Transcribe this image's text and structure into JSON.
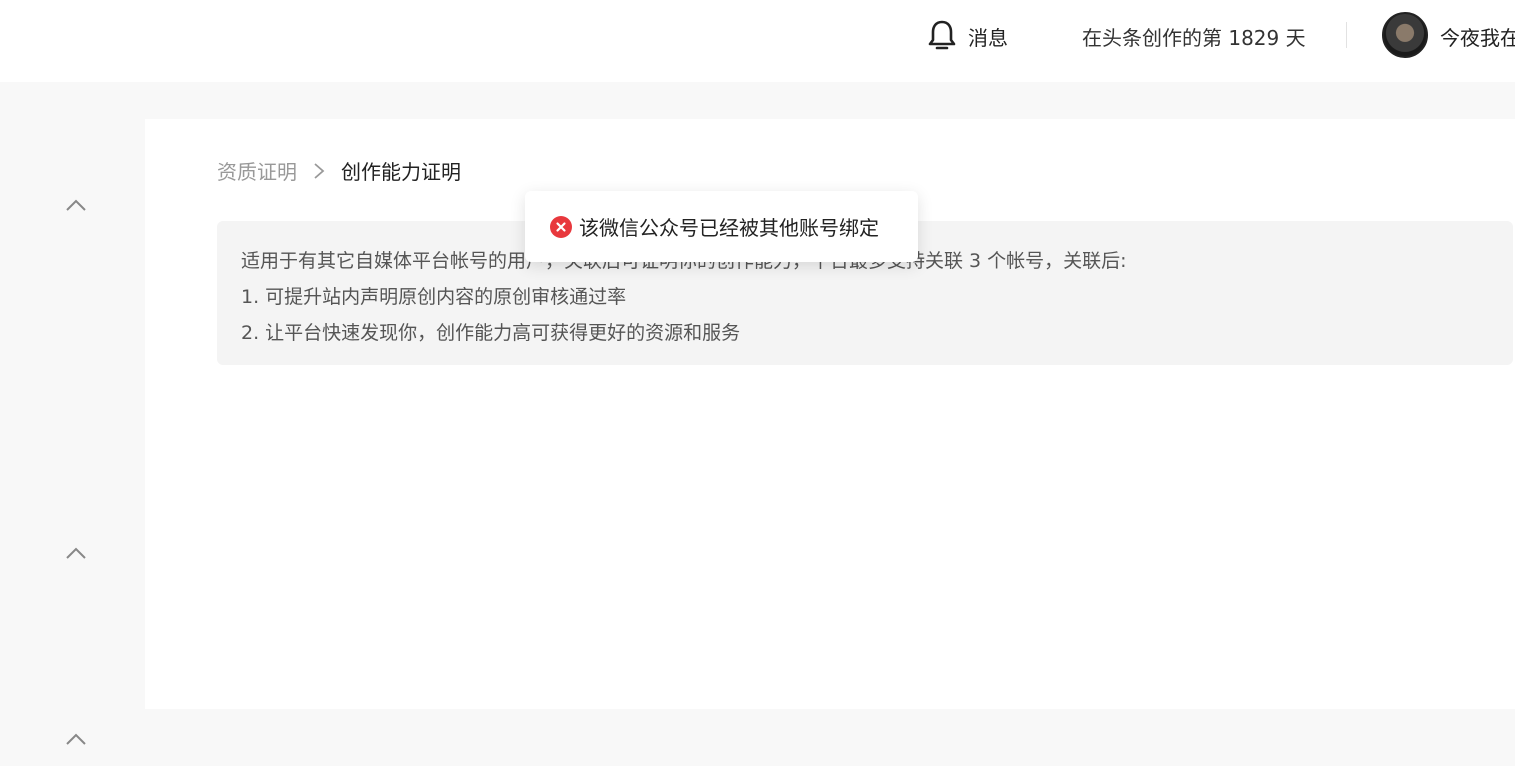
{
  "header": {
    "notification_label": "消息",
    "creation_days": "在头条创作的第 1829 天",
    "username": "今夜我在"
  },
  "breadcrumb": {
    "parent": "资质证明",
    "current": "创作能力证明"
  },
  "info": {
    "lines": [
      "适用于有其它自媒体平台帐号的用户，关联后可证明你的创作能力，平台最多支持关联 3 个帐号，关联后:",
      "1. 可提升站内声明原创内容的原创审核通过率",
      "2. 让平台快速发现你，创作能力高可获得更好的资源和服务"
    ]
  },
  "toast": {
    "message": "该微信公众号已经被其他账号绑定",
    "type": "error"
  },
  "colors": {
    "error": "#e8383d",
    "background": "#f8f8f8",
    "card": "#ffffff",
    "info_box": "#f4f4f4"
  },
  "icons": {
    "notification": "bell-icon",
    "breadcrumb_separator": "chevron-right-icon",
    "sidebar_toggle": "chevron-up-icon",
    "toast": "error-circle-icon"
  }
}
